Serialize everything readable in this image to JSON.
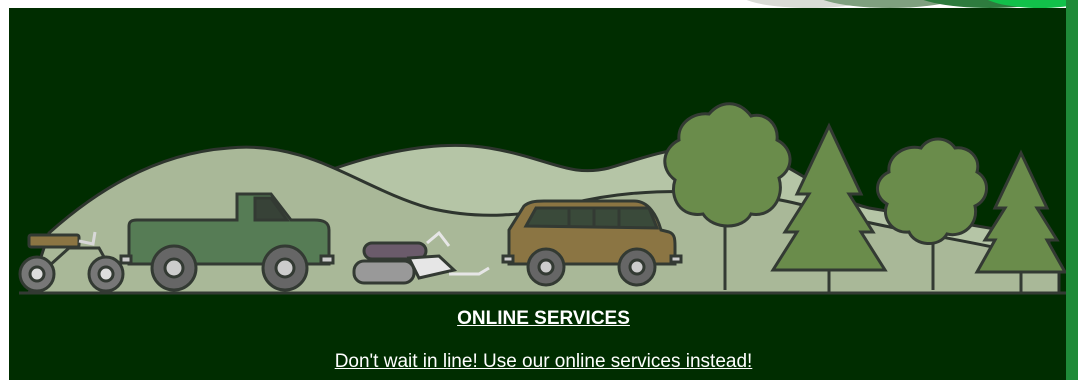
{
  "online": {
    "title": "ONLINE SERVICES",
    "subtitle": "Don't wait in line! Use our online services instead!"
  },
  "colors": {
    "background": "#002d00",
    "hills_back": "#b5c5a6",
    "hills_front": "#a9b898",
    "truck": "#567c55",
    "suv": "#8b7543",
    "tree": "#6a8c4b",
    "outline": "#333a33",
    "accent_strip": "#1f8a38"
  },
  "illustration": {
    "items": [
      "motorcycle-icon",
      "pickup-truck-icon",
      "snowmobile-icon",
      "suv-icon",
      "deciduous-tree-icon",
      "pine-tree-icon"
    ]
  }
}
